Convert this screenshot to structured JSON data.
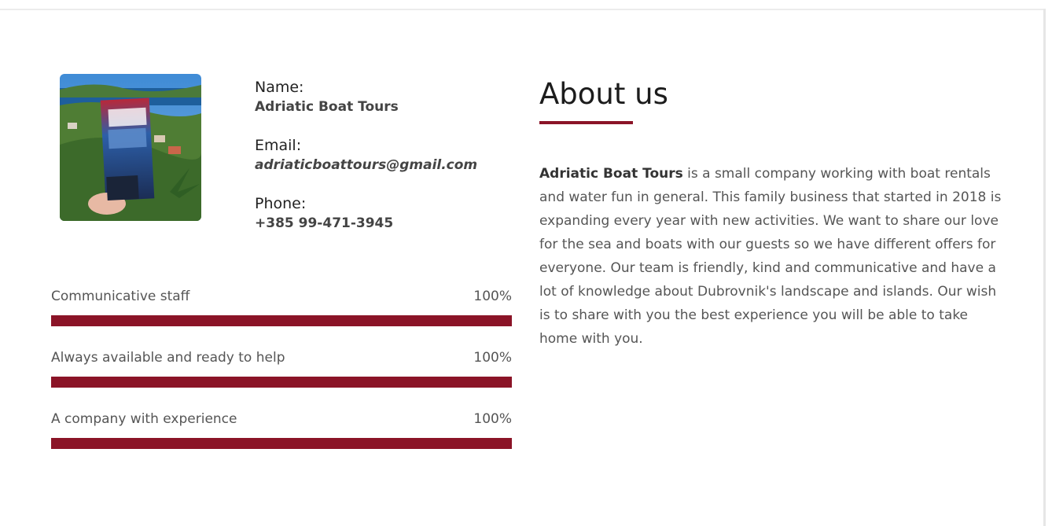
{
  "profile": {
    "name_label": "Name:",
    "name_value": "Adriatic Boat Tours",
    "email_label": "Email:",
    "email_value": "adriaticboattours@gmail.com",
    "phone_label": "Phone:",
    "phone_value": "+385 99-471-3945"
  },
  "skills": [
    {
      "label": "Communicative staff",
      "percent_text": "100%",
      "value": 1.0
    },
    {
      "label": "Always available and ready to help",
      "percent_text": "100%",
      "value": 1.0
    },
    {
      "label": "A company with experience",
      "percent_text": "100%",
      "value": 1.0
    }
  ],
  "about": {
    "title": "About us",
    "company_bold": "Adriatic Boat Tours",
    "text": " is a small company working with boat rentals and water fun in general. This family business that started in 2018 is expanding every year with new activities. We want to share our love for the sea and boats with our guests so we have different offers for everyone. Our team is friendly, kind and communicative and have a lot of knowledge about Dubrovnik's landscape and islands. Our wish is to share with you the best experience you will be able to take home with you."
  },
  "colors": {
    "accent": "#8b1427"
  }
}
